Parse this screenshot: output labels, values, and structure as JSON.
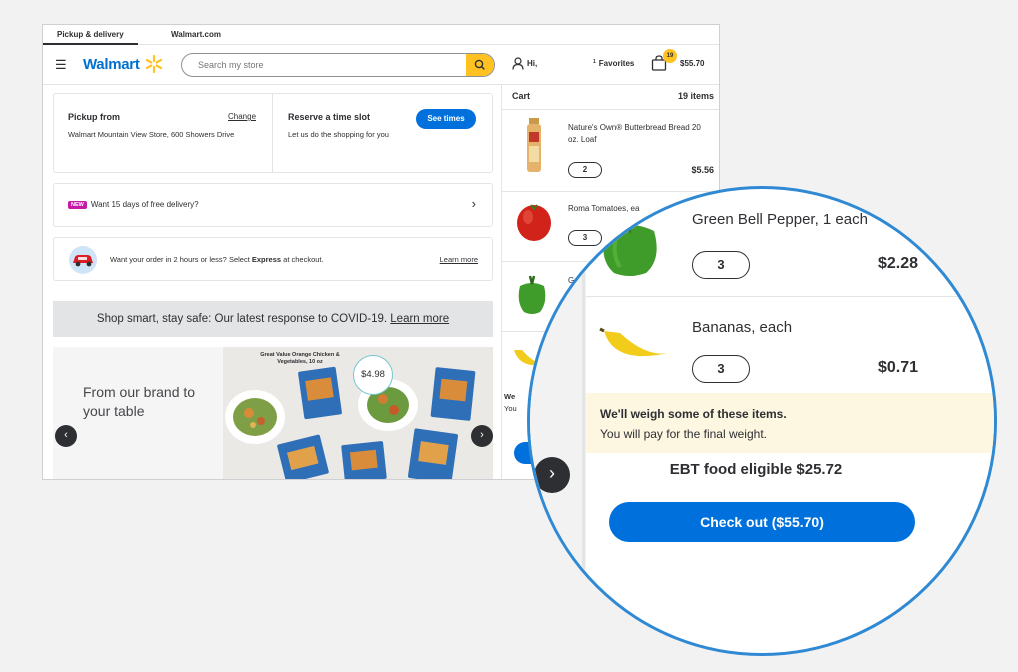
{
  "tabs": [
    "Pickup & delivery",
    "Walmart.com"
  ],
  "header": {
    "logo": "Walmart",
    "search_placeholder": "Search my store",
    "account": "Hi,",
    "favorites_sup": "1",
    "favorites": "Favorites",
    "cart_count": "19",
    "cart_total": "$55.70"
  },
  "pickup": {
    "title": "Pickup from",
    "change": "Change",
    "address": "Walmart Mountain View Store, 600 Showers Drive",
    "reserve_title": "Reserve a time slot",
    "reserve_sub": "Let us do the shopping for you",
    "see_times": "See times"
  },
  "delivery_promo": {
    "badge": "NEW",
    "text": "Want 15 days of free delivery?"
  },
  "express": {
    "text_before": "Want your order in 2 hours or less? Select ",
    "text_bold": "Express",
    "text_after": " at checkout.",
    "link": "Learn more"
  },
  "covid": {
    "text": "Shop smart, stay safe: Our latest response to COVID-19. ",
    "link": "Learn more"
  },
  "promo": {
    "title": "From our brand to your table",
    "caption": "Great Value Orange Chicken & Vegetables, 10 oz",
    "price": "$4.98"
  },
  "cart": {
    "title": "Cart",
    "count_label": "19 items",
    "items": [
      {
        "name": "Nature's Own® Butterbread Bread 20 oz. Loaf",
        "qty": "2",
        "price": "$5.56"
      },
      {
        "name": "Roma Tomatoes, ea",
        "qty": "3",
        "price": ""
      },
      {
        "name": "G",
        "qty": "",
        "price": ""
      },
      {
        "name": "We",
        "sub": "You",
        "qty": "",
        "price": ""
      }
    ]
  },
  "zoom": {
    "items": [
      {
        "name": "Green Bell Pepper, 1 each",
        "qty": "3",
        "price": "$2.28"
      },
      {
        "name": "Bananas, each",
        "qty": "3",
        "price": "$0.71"
      }
    ],
    "weigh_title": "We'll weigh some of these items.",
    "weigh_sub": "You will pay for the final weight.",
    "ebt": "EBT food eligible $25.72",
    "checkout": "Check out ($55.70)"
  },
  "colors": {
    "brand_blue": "#0071dc",
    "spark_yellow": "#ffc220",
    "zoom_ring": "#2f89d3",
    "weigh_bg": "#fdf6e0"
  }
}
